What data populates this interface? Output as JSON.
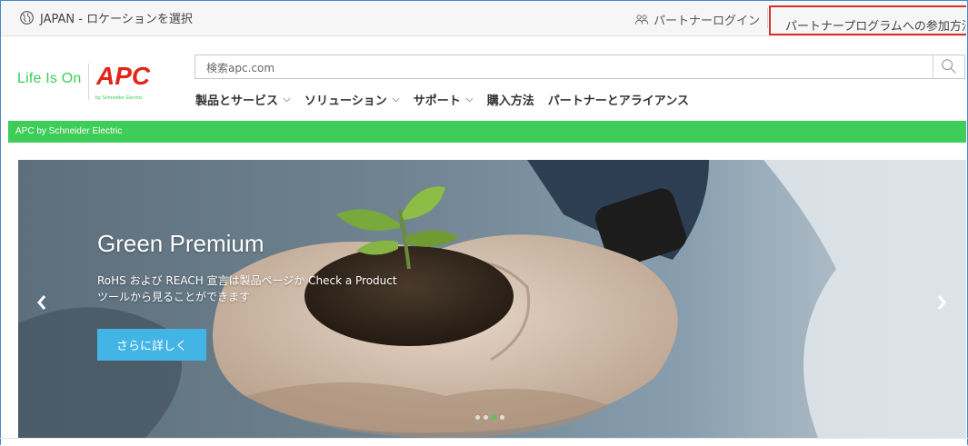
{
  "topbar": {
    "location_label": "JAPAN - ロケーションを選択",
    "partner_login_label": "パートナーログイン",
    "partner_program_label": "パートナープログラムへの参加方法"
  },
  "brand": {
    "tagline": "Life Is On",
    "logo": "APC",
    "logo_sub": "by Schneider Electric"
  },
  "search": {
    "placeholder": "検索apc.com",
    "icon": "search-icon"
  },
  "nav": {
    "items": [
      {
        "label": "製品とサービス",
        "has_dropdown": true
      },
      {
        "label": "ソリューション",
        "has_dropdown": true
      },
      {
        "label": "サポート",
        "has_dropdown": true
      },
      {
        "label": "購入方法",
        "has_dropdown": false
      },
      {
        "label": "パートナーとアライアンス",
        "has_dropdown": false
      }
    ]
  },
  "band": {
    "label": "APC by Schneider Electric"
  },
  "hero": {
    "title": "Green Premium",
    "description_line1": "RoHS および REACH 宣言は製品ページか Check a Product",
    "description_line2": "ツールから見ることができます",
    "button_label": "さらに詳しく",
    "slides_total": 4,
    "active_slide": 3
  },
  "colors": {
    "brand_green": "#3dcd58",
    "apc_red": "#e1251b",
    "button_blue": "#42b4e6",
    "highlight_red": "#d6322c"
  }
}
